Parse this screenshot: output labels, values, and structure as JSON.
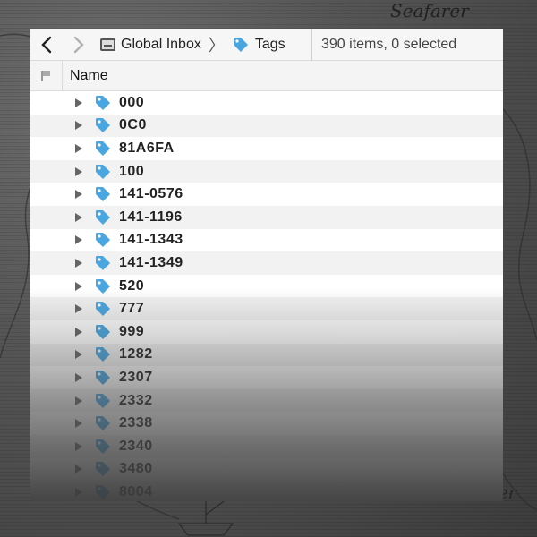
{
  "background": {
    "label_top": "Seafarer",
    "label_bottom": "Wanderer"
  },
  "toolbar": {
    "back_icon": "chevron-left-icon",
    "forward_icon": "chevron-right-icon",
    "breadcrumb": [
      {
        "label": "Global Inbox",
        "icon": "inbox-icon"
      },
      {
        "label": "Tags",
        "icon": "tag-icon"
      }
    ],
    "status": "390 items, 0 selected"
  },
  "columns": {
    "flag_icon": "flag-icon",
    "name": "Name"
  },
  "colors": {
    "tag_blue": "#4aa6e0",
    "window_bg": "#ffffff",
    "row_alt": "#f2f2f2"
  },
  "rows": [
    {
      "label": "000"
    },
    {
      "label": "0C0"
    },
    {
      "label": "81A6FA"
    },
    {
      "label": "100"
    },
    {
      "label": "141-0576"
    },
    {
      "label": "141-1196"
    },
    {
      "label": "141-1343"
    },
    {
      "label": "141-1349"
    },
    {
      "label": "520"
    },
    {
      "label": "777"
    },
    {
      "label": "999"
    },
    {
      "label": "1282"
    },
    {
      "label": "2307"
    },
    {
      "label": "2332"
    },
    {
      "label": "2338"
    },
    {
      "label": "2340"
    },
    {
      "label": "3480"
    },
    {
      "label": "8004"
    }
  ]
}
